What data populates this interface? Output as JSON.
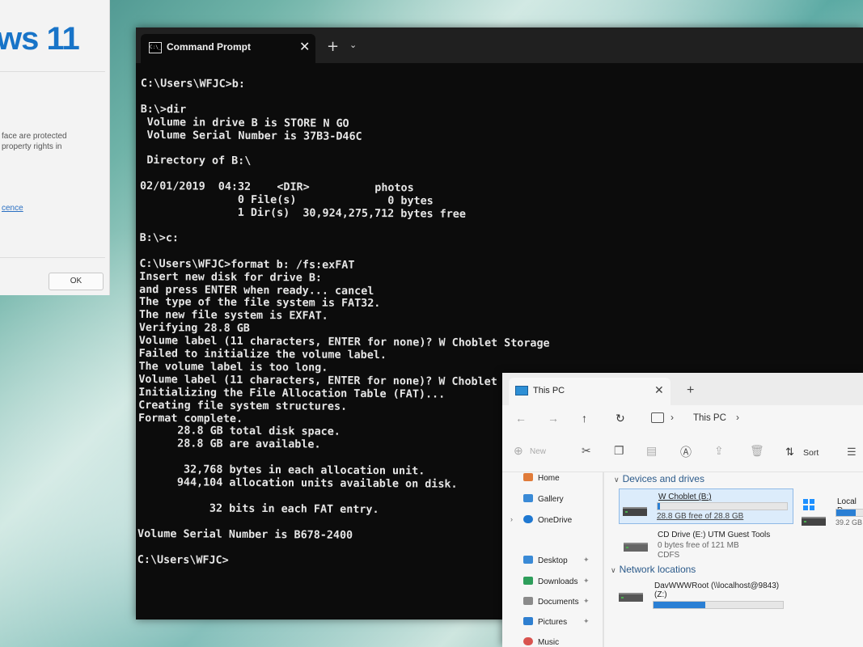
{
  "about_dialog": {
    "brand": "ws 11",
    "legal_text": "face are protected\nproperty rights in",
    "licence_link": "cence",
    "ok_button": "OK"
  },
  "cmd": {
    "tab_title": "Command Prompt",
    "icon_text": "C:\\_",
    "close": "✕",
    "new_tab": "+",
    "dropdown": "⌄",
    "output": "C:\\Users\\WFJC>b:\n\nB:\\>dir\n Volume in drive B is STORE N GO\n Volume Serial Number is 37B3-D46C\n\n Directory of B:\\\n\n02/01/2019  04:32    <DIR>          photos\n               0 File(s)              0 bytes\n               1 Dir(s)  30,924,275,712 bytes free\n\nB:\\>c:\n\nC:\\Users\\WFJC>format b: /fs:exFAT\nInsert new disk for drive B:\nand press ENTER when ready... cancel\nThe type of the file system is FAT32.\nThe new file system is EXFAT.\nVerifying 28.8 GB\nVolume label (11 characters, ENTER for none)? W Choblet Storage\nFailed to initialize the volume label.\nThe volume label is too long.\nVolume label (11 characters, ENTER for none)? W Choblet\nInitializing the File Allocation Table (FAT)...\nCreating file system structures.\nFormat complete.\n      28.8 GB total disk space.\n      28.8 GB are available.\n\n       32,768 bytes in each allocation unit.\n      944,104 allocation units available on disk.\n\n           32 bits in each FAT entry.\n\nVolume Serial Number is B678-2400\n\nC:\\Users\\WFJC>"
  },
  "explorer": {
    "tab_title": "This PC",
    "close": "✕",
    "new_tab": "+",
    "breadcrumb": "This PC",
    "toolbar": {
      "new_label": "New",
      "sort_label": "Sort"
    },
    "nav": {
      "home": "Home",
      "gallery": "Gallery",
      "onedrive": "OneDrive",
      "desktop": "Desktop",
      "downloads": "Downloads",
      "documents": "Documents",
      "pictures": "Pictures",
      "music": "Music"
    },
    "sections": {
      "devices": "Devices and drives",
      "network": "Network locations"
    },
    "drives": {
      "b": {
        "name": "W Choblet (B:)",
        "free": "28.8 GB free of 28.8 GB",
        "used_fraction": 0.02
      },
      "e": {
        "name": "CD Drive (E:) UTM Guest Tools",
        "free": "0 bytes free of 121 MB",
        "fs": "CDFS"
      },
      "local": {
        "name": "Local D",
        "size": "39.2 GB",
        "used_fraction": 0.6
      },
      "z": {
        "name": "DavWWWRoot (\\\\localhost@9843)",
        "letter": "(Z:)",
        "used_fraction": 0.4
      }
    }
  }
}
